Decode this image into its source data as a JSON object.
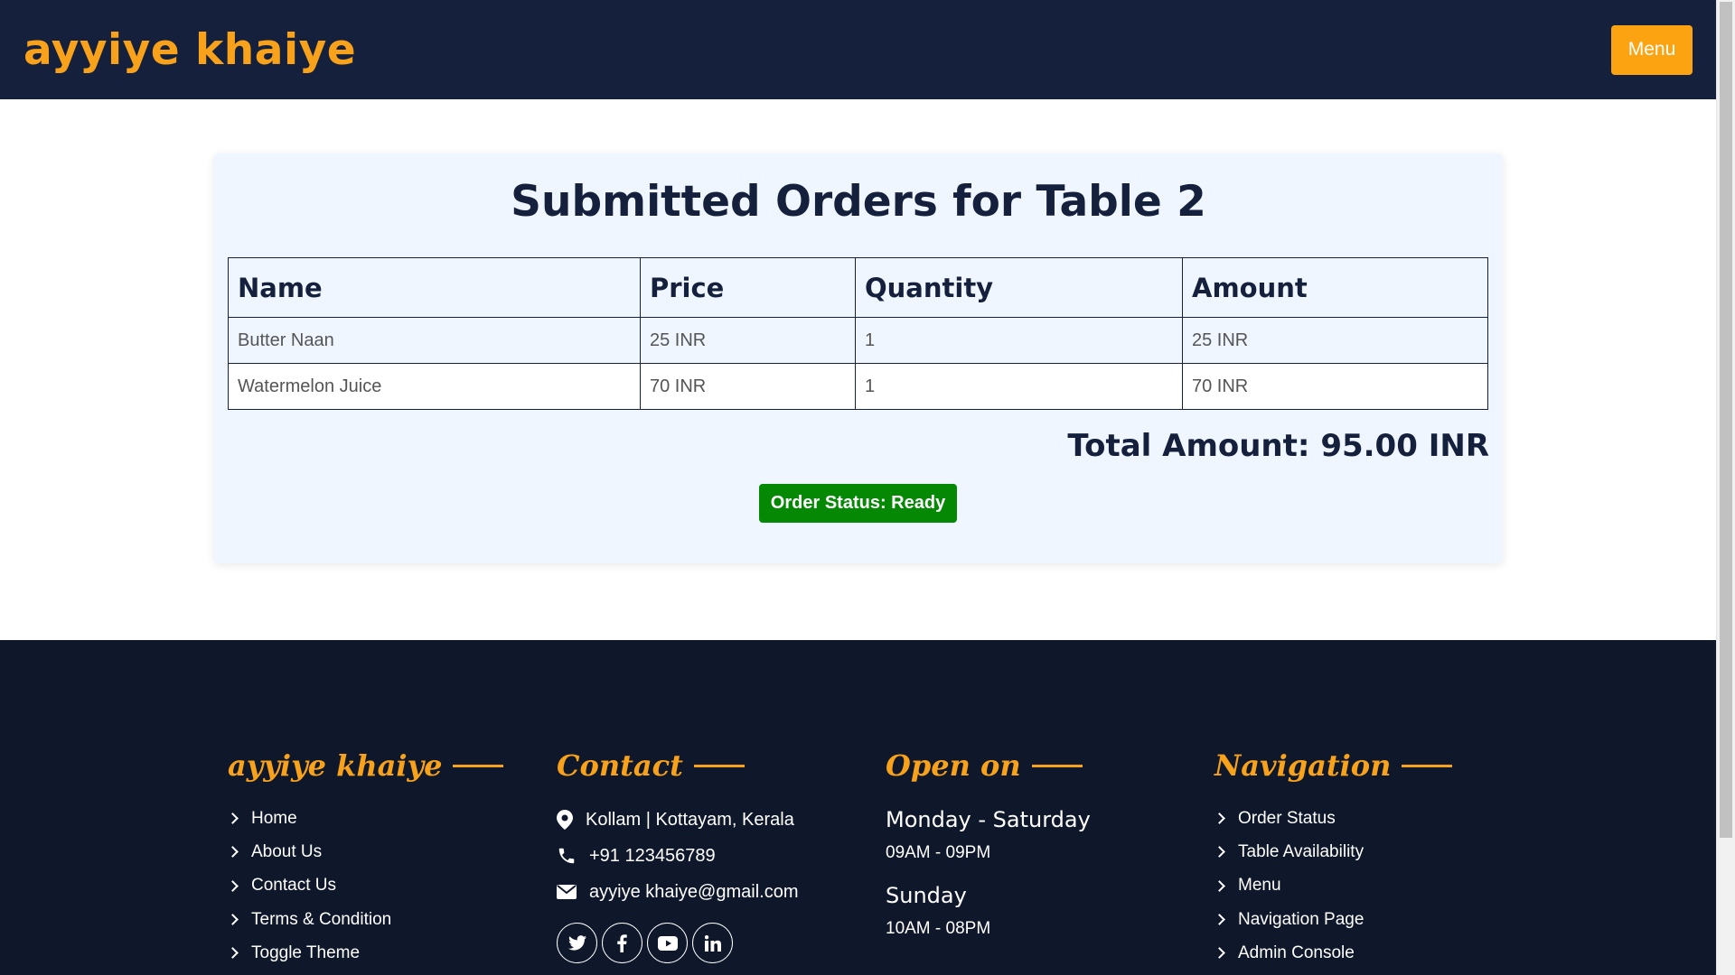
{
  "header": {
    "brand": "ayyiye khaiye",
    "menu_label": "Menu"
  },
  "orders": {
    "title": "Submitted Orders for Table 2",
    "columns": [
      "Name",
      "Price",
      "Quantity",
      "Amount"
    ],
    "rows": [
      [
        "Butter Naan",
        "25 INR",
        "1",
        "25 INR"
      ],
      [
        "Watermelon Juice",
        "70 INR",
        "1",
        "70 INR"
      ]
    ],
    "total": "Total Amount: 95.00 INR",
    "status": "Order Status: Ready",
    "status_color": "#058905"
  },
  "footer": {
    "brand_heading": "ayyiye khaiye",
    "brand_links": [
      "Home",
      "About Us",
      "Contact Us",
      "Terms & Condition",
      "Toggle Theme"
    ],
    "contact_heading": "Contact",
    "contact": {
      "address": "Kollam | Kottayam, Kerala",
      "phone": "+91 123456789",
      "email": "ayyiye khaiye@gmail.com"
    },
    "socials": [
      "twitter-icon",
      "facebook-icon",
      "youtube-icon",
      "linkedin-icon"
    ],
    "open_heading": "Open on",
    "hours": [
      {
        "day": "Monday - Saturday",
        "time": "09AM - 09PM"
      },
      {
        "day": "Sunday",
        "time": "10AM - 08PM"
      }
    ],
    "nav_heading": "Navigation",
    "nav_links": [
      "Order Status",
      "Table Availability",
      "Menu",
      "Navigation Page",
      "Admin Console"
    ]
  },
  "colors": {
    "header_bg": "#14203c",
    "footer_bg": "#0f172a",
    "accent": "#f8a21b",
    "card_bg": "#eff6ff"
  }
}
